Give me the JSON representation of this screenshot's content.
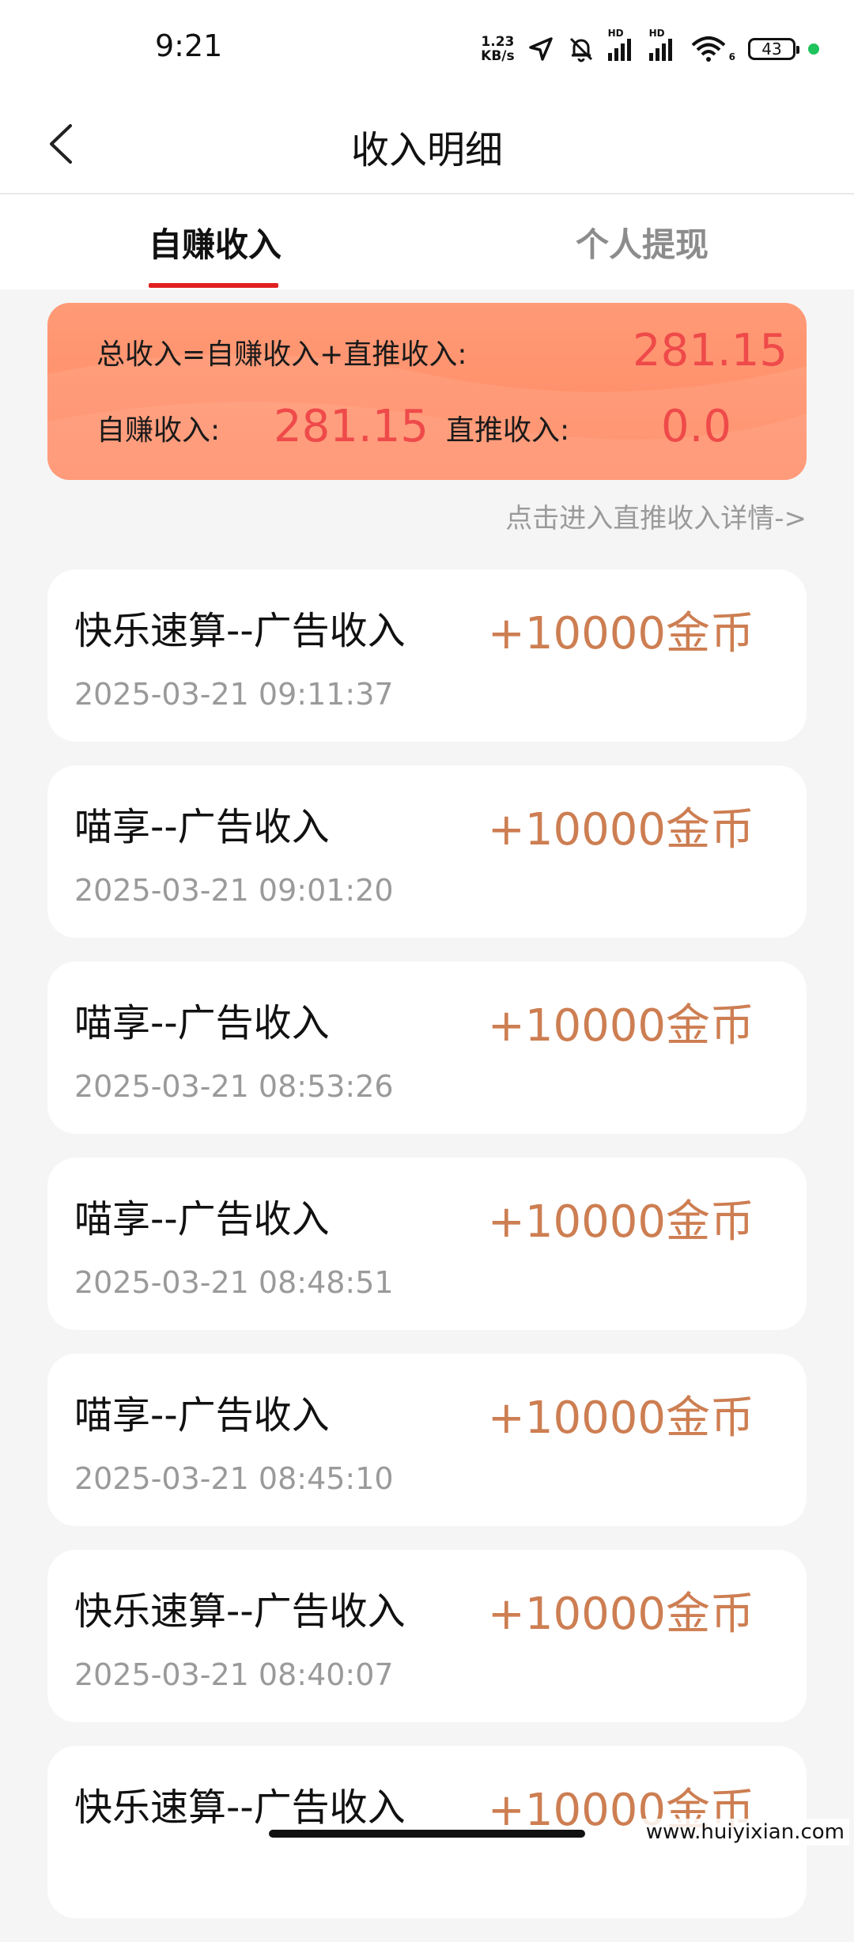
{
  "status_bar": {
    "time": "9:21",
    "net_speed_value": "1.23",
    "net_speed_unit": "KB/s",
    "signal_1_tag": "HD",
    "signal_2_tag": "HD",
    "wifi_tag": "6",
    "battery": "43",
    "icons": [
      "location-arrow-icon",
      "mute-bell-icon",
      "signal-icon",
      "signal-icon",
      "wifi-icon",
      "battery-icon"
    ]
  },
  "header": {
    "title": "收入明细"
  },
  "tabs": [
    {
      "label": "自赚收入",
      "active": true
    },
    {
      "label": "个人提现",
      "active": false
    }
  ],
  "summary": {
    "total_label": "总收入=自赚收入+直推收入:",
    "total_value": "281.15",
    "self_label": "自赚收入:",
    "self_value": "281.15",
    "direct_label": "直推收入:",
    "direct_value": "0.0"
  },
  "detail_link": "点击进入直推收入详情->",
  "records": [
    {
      "title": "快乐速算--广告收入",
      "amount": "+10000金币",
      "time": "2025-03-21 09:11:37"
    },
    {
      "title": "喵享--广告收入",
      "amount": "+10000金币",
      "time": "2025-03-21 09:01:20"
    },
    {
      "title": "喵享--广告收入",
      "amount": "+10000金币",
      "time": "2025-03-21 08:53:26"
    },
    {
      "title": "喵享--广告收入",
      "amount": "+10000金币",
      "time": "2025-03-21 08:48:51"
    },
    {
      "title": "喵享--广告收入",
      "amount": "+10000金币",
      "time": "2025-03-21 08:45:10"
    },
    {
      "title": "快乐速算--广告收入",
      "amount": "+10000金币",
      "time": "2025-03-21 08:40:07"
    },
    {
      "title": "快乐速算--广告收入",
      "amount": "+10000金币",
      "time": ""
    }
  ],
  "watermark": "www.huiyixian.com",
  "colors": {
    "accent_red": "#e02020",
    "card_orange": "#ff8a64",
    "value_red": "#ef4a4a",
    "amount_brown": "#cd7e52"
  }
}
